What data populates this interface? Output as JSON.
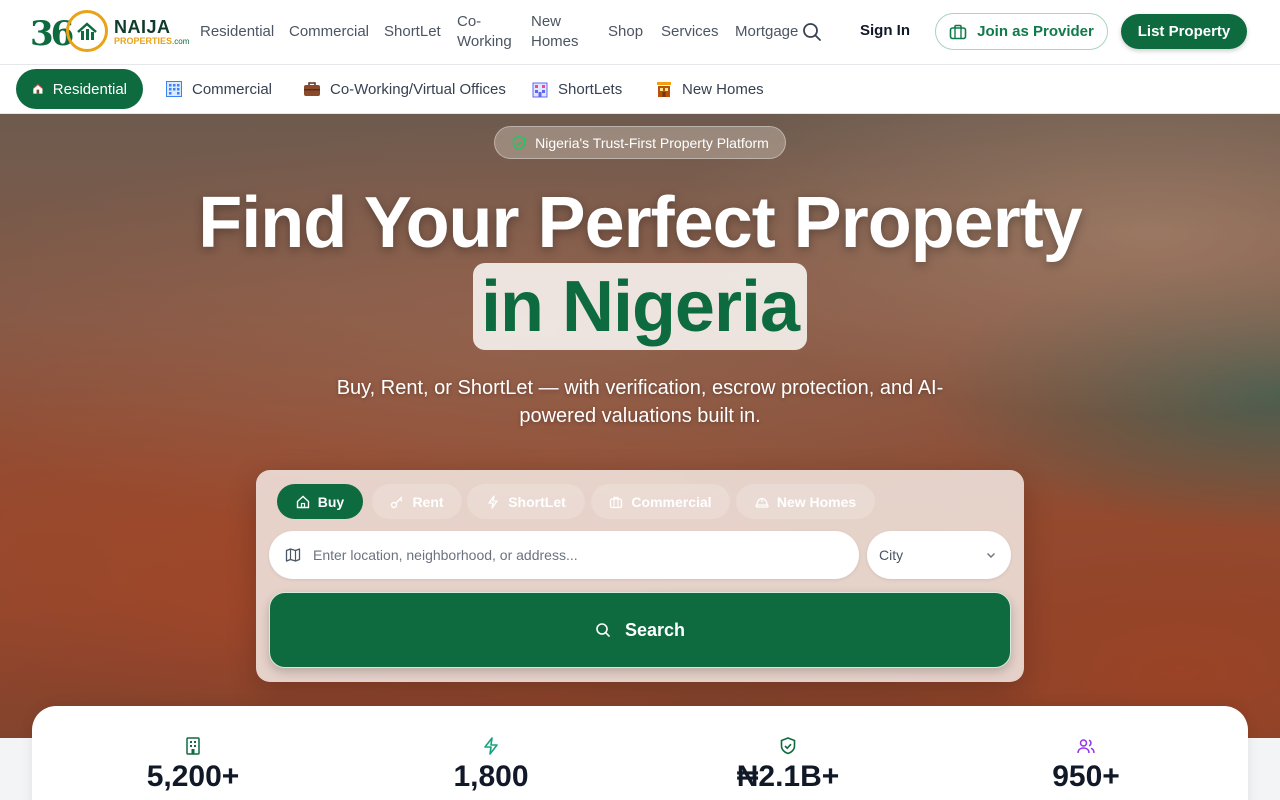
{
  "brand": {
    "logo_number": "36",
    "name_line1": "NAIJA",
    "name_line2": "PROPERTIES",
    "name_suffix": ".com"
  },
  "nav": {
    "items": [
      {
        "label": "Residential"
      },
      {
        "label": "Commercial"
      },
      {
        "label": "ShortLet"
      },
      {
        "label_line1": "Co-",
        "label_line2": "Working"
      },
      {
        "label_line1": "New",
        "label_line2": "Homes"
      },
      {
        "label": "Shop"
      },
      {
        "label": "Services"
      },
      {
        "label": "Mortgage"
      }
    ],
    "sign_in": "Sign In",
    "join_provider": "Join as Provider",
    "list_property": "List Property"
  },
  "categories": [
    {
      "label": "Residential",
      "active": true
    },
    {
      "label": "Commercial"
    },
    {
      "label": "Co-Working/Virtual Offices"
    },
    {
      "label": "ShortLets"
    },
    {
      "label": "New Homes"
    }
  ],
  "hero": {
    "badge": "Nigeria's Trust-First Property Platform",
    "headline_line1": "Find Your Perfect Property",
    "headline_line2": "in Nigeria",
    "subtitle": "Buy, Rent, or ShortLet — with verification, escrow protection, and AI-powered valuations built in."
  },
  "search": {
    "tabs": [
      {
        "label": "Buy",
        "active": true
      },
      {
        "label": "Rent"
      },
      {
        "label": "ShortLet"
      },
      {
        "label": "Commercial"
      },
      {
        "label": "New Homes"
      }
    ],
    "location_placeholder": "Enter location, neighborhood, or address...",
    "city_value": "City",
    "button_label": "Search"
  },
  "stats": [
    {
      "value": "5,200+",
      "icon": "building-icon",
      "color": "#0e6b3f"
    },
    {
      "value": "1,800",
      "icon": "bolt-icon",
      "color": "#14a37f"
    },
    {
      "value": "₦2.1B+",
      "icon": "shield-check-icon",
      "color": "#0e6b3f"
    },
    {
      "value": "950+",
      "icon": "users-icon",
      "color": "#9333ea"
    }
  ],
  "colors": {
    "brand_green": "#0e6b3f",
    "brand_gold": "#e8a319"
  }
}
